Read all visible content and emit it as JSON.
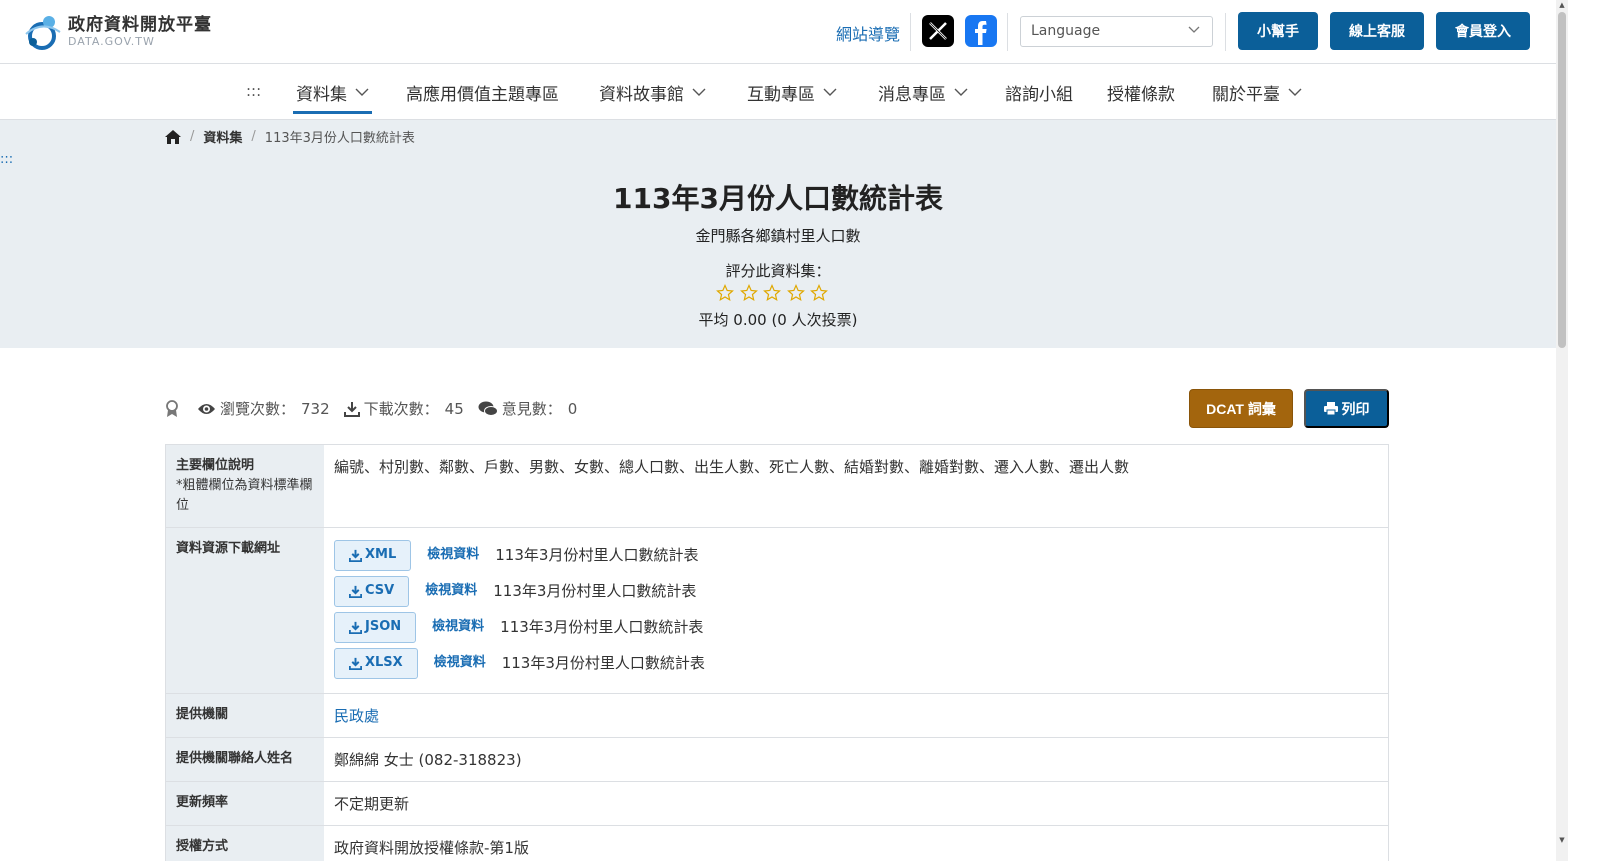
{
  "header": {
    "logo_title": "政府資料開放平臺",
    "logo_sub": "DATA.GOV.TW",
    "sitemap": "網站導覽",
    "language_placeholder": "Language",
    "buttons": [
      "小幫手",
      "線上客服",
      "會員登入"
    ]
  },
  "nav": {
    "dots": ":::",
    "items": [
      {
        "label": "資料集",
        "dropdown": true
      },
      {
        "label": "高應用價值主題專區",
        "dropdown": false
      },
      {
        "label": "資料故事館",
        "dropdown": true
      },
      {
        "label": "互動專區",
        "dropdown": true
      },
      {
        "label": "消息專區",
        "dropdown": true
      },
      {
        "label": "諮詢小組",
        "dropdown": false
      },
      {
        "label": "授權條款",
        "dropdown": false
      },
      {
        "label": "關於平臺",
        "dropdown": true
      }
    ]
  },
  "breadcrumb": {
    "section": "資料集",
    "current": "113年3月份人口數統計表"
  },
  "side_dots": ":::",
  "dataset": {
    "title": "113年3月份人口數統計表",
    "description": "金門縣各鄉鎮村里人口數",
    "rate_label": "評分此資料集：",
    "rating": 0,
    "rating_max": 5,
    "average": "平均 0.00 (0 人次投票)"
  },
  "stats": {
    "views_label": "瀏覽次數：",
    "views": "732",
    "downloads_label": "下載次數：",
    "downloads": "45",
    "comments_label": "意見數：",
    "comments": "0"
  },
  "actions": {
    "dcat": "DCAT 詞彙",
    "print": "列印"
  },
  "info": {
    "fields_label": "主要欄位說明",
    "fields_note": "*粗體欄位為資料標準欄位",
    "fields_value": "編號、村別數、鄰數、戶數、男數、女數、總人口數、出生人數、死亡人數、結婚對數、離婚對數、遷入人數、遷出人數",
    "resources_label": "資料資源下載網址",
    "resources": [
      {
        "format": "XML",
        "view": "檢視資料",
        "name": "113年3月份村里人口數統計表"
      },
      {
        "format": "CSV",
        "view": "檢視資料",
        "name": "113年3月份村里人口數統計表"
      },
      {
        "format": "JSON",
        "view": "檢視資料",
        "name": "113年3月份村里人口數統計表"
      },
      {
        "format": "XLSX",
        "view": "檢視資料",
        "name": "113年3月份村里人口數統計表"
      }
    ],
    "org_label": "提供機關",
    "org_value": "民政處",
    "contact_label": "提供機關聯絡人姓名",
    "contact_value": "鄭綿綿 女士 (082-318823)",
    "freq_label": "更新頻率",
    "freq_value": "不定期更新",
    "license_label": "授權方式",
    "license_value": "政府資料開放授權條款-第1版"
  },
  "colors": {
    "primary": "#0b5f99",
    "link": "#1a6db3",
    "dcat": "#a3650d",
    "hero_bg": "#e9eef2",
    "star": "#e0a800"
  },
  "icons": [
    "home-icon",
    "x-icon",
    "facebook-icon",
    "chevron-down-icon",
    "star-icon",
    "award-icon",
    "eye-icon",
    "download-icon",
    "comments-icon",
    "print-icon"
  ]
}
